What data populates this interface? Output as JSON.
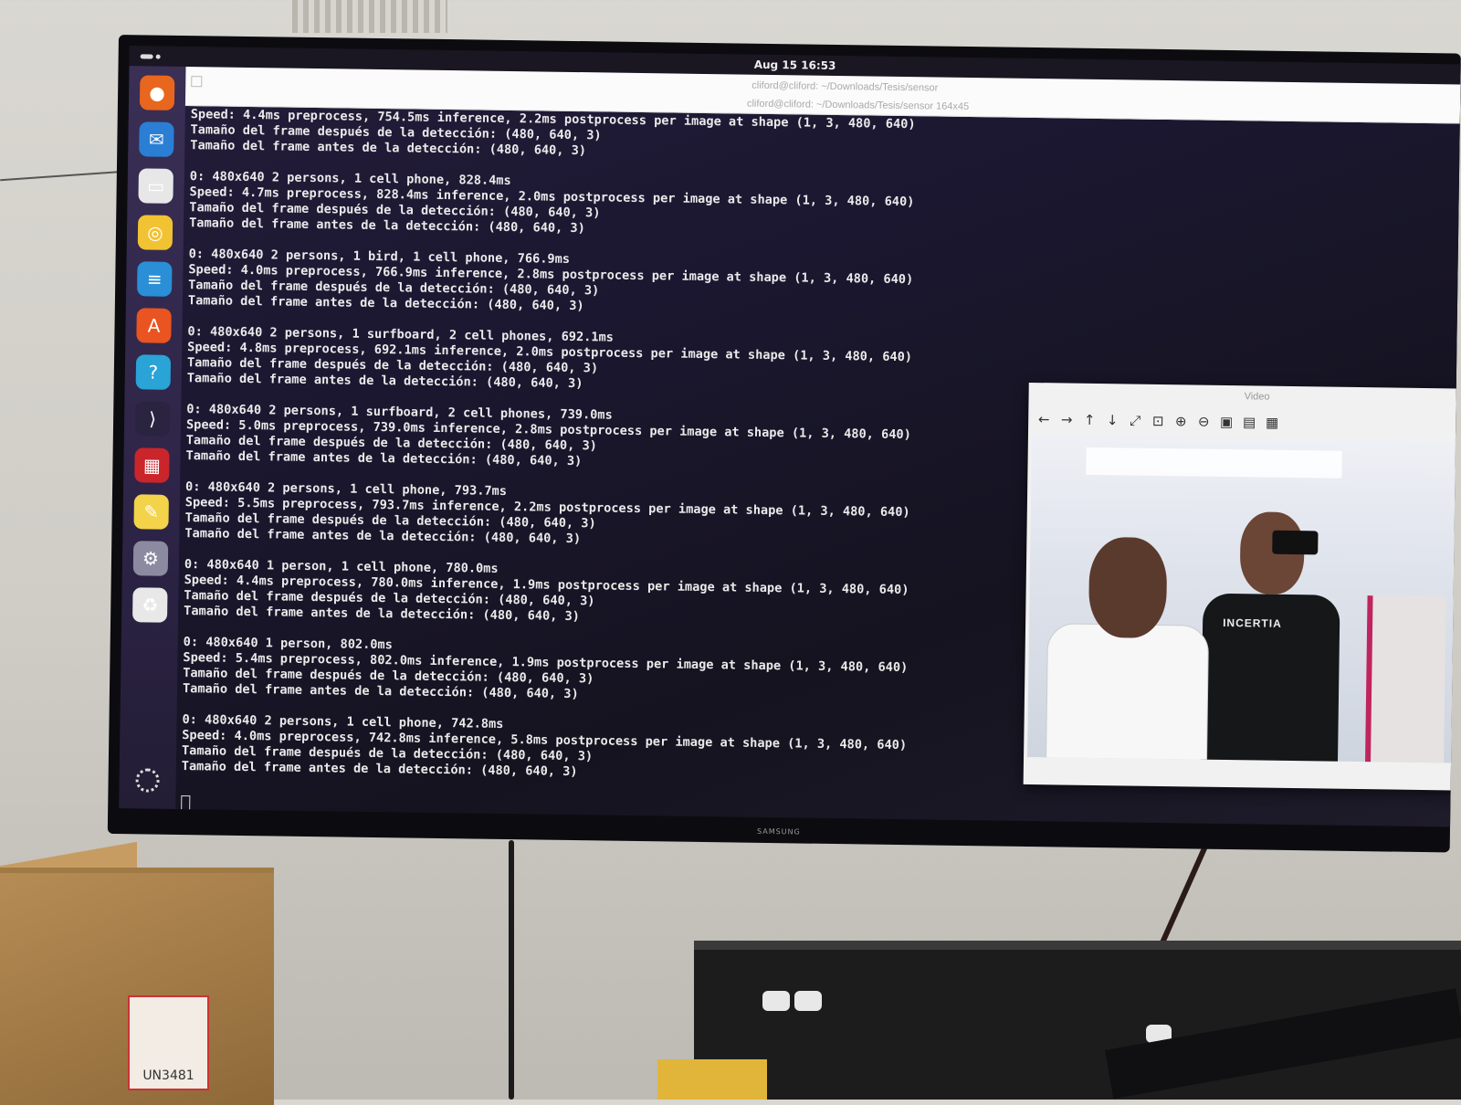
{
  "topbar": {
    "clock": "Aug 15  16:53"
  },
  "terminal": {
    "title_main": "cliford@cliford: ~/Downloads/Tesis/sensor",
    "title_tab": "cliford@cliford: ~/Downloads/Tesis/sensor 164x45",
    "blocks": [
      [
        "Speed: 4.4ms preprocess, 754.5ms inference, 2.2ms postprocess per image at shape (1, 3, 480, 640)",
        "Tamaño del frame después de la detección: (480, 640, 3)",
        "Tamaño del frame antes de la detección: (480, 640, 3)"
      ],
      [
        "0: 480x640 2 persons, 1 cell phone, 828.4ms",
        "Speed: 4.7ms preprocess, 828.4ms inference, 2.0ms postprocess per image at shape (1, 3, 480, 640)",
        "Tamaño del frame después de la detección: (480, 640, 3)",
        "Tamaño del frame antes de la detección: (480, 640, 3)"
      ],
      [
        "0: 480x640 2 persons, 1 bird, 1 cell phone, 766.9ms",
        "Speed: 4.0ms preprocess, 766.9ms inference, 2.8ms postprocess per image at shape (1, 3, 480, 640)",
        "Tamaño del frame después de la detección: (480, 640, 3)",
        "Tamaño del frame antes de la detección: (480, 640, 3)"
      ],
      [
        "0: 480x640 2 persons, 1 surfboard, 2 cell phones, 692.1ms",
        "Speed: 4.8ms preprocess, 692.1ms inference, 2.0ms postprocess per image at shape (1, 3, 480, 640)",
        "Tamaño del frame después de la detección: (480, 640, 3)",
        "Tamaño del frame antes de la detección: (480, 640, 3)"
      ],
      [
        "0: 480x640 2 persons, 1 surfboard, 2 cell phones, 739.0ms",
        "Speed: 5.0ms preprocess, 739.0ms inference, 2.8ms postprocess per image at shape (1, 3, 480, 640)",
        "Tamaño del frame después de la detección: (480, 640, 3)",
        "Tamaño del frame antes de la detección: (480, 640, 3)"
      ],
      [
        "0: 480x640 2 persons, 1 cell phone, 793.7ms",
        "Speed: 5.5ms preprocess, 793.7ms inference, 2.2ms postprocess per image at shape (1, 3, 480, 640)",
        "Tamaño del frame después de la detección: (480, 640, 3)",
        "Tamaño del frame antes de la detección: (480, 640, 3)"
      ],
      [
        "0: 480x640 1 person, 1 cell phone, 780.0ms",
        "Speed: 4.4ms preprocess, 780.0ms inference, 1.9ms postprocess per image at shape (1, 3, 480, 640)",
        "Tamaño del frame después de la detección: (480, 640, 3)",
        "Tamaño del frame antes de la detección: (480, 640, 3)"
      ],
      [
        "0: 480x640 1 person, 802.0ms",
        "Speed: 5.4ms preprocess, 802.0ms inference, 1.9ms postprocess per image at shape (1, 3, 480, 640)",
        "Tamaño del frame después de la detección: (480, 640, 3)",
        "Tamaño del frame antes de la detección: (480, 640, 3)"
      ],
      [
        "0: 480x640 2 persons, 1 cell phone, 742.8ms",
        "Speed: 4.0ms preprocess, 742.8ms inference, 5.8ms postprocess per image at shape (1, 3, 480, 640)",
        "Tamaño del frame después de la detección: (480, 640, 3)",
        "Tamaño del frame antes de la detección: (480, 640, 3)"
      ]
    ]
  },
  "video_window": {
    "title": "Video",
    "toolbar": [
      {
        "name": "pan-left-icon",
        "glyph": "←"
      },
      {
        "name": "pan-right-icon",
        "glyph": "→"
      },
      {
        "name": "pan-up-icon",
        "glyph": "↑"
      },
      {
        "name": "pan-down-icon",
        "glyph": "↓"
      },
      {
        "name": "zoom-fit-icon",
        "glyph": "⤢"
      },
      {
        "name": "zoom-original-icon",
        "glyph": "⊡"
      },
      {
        "name": "zoom-in-icon",
        "glyph": "⊕"
      },
      {
        "name": "zoom-out-icon",
        "glyph": "⊖"
      },
      {
        "name": "save-image-icon",
        "glyph": "▣"
      },
      {
        "name": "copy-image-icon",
        "glyph": "▤"
      },
      {
        "name": "properties-icon",
        "glyph": "▦"
      }
    ],
    "shirt_text": "INCERTIA"
  },
  "dock": [
    {
      "name": "firefox-icon",
      "bg": "#e8661e",
      "glyph": "●"
    },
    {
      "name": "thunderbird-icon",
      "bg": "#2a7fd4",
      "glyph": "✉"
    },
    {
      "name": "files-icon",
      "bg": "#e7e7e7",
      "glyph": "▭"
    },
    {
      "name": "rhythmbox-icon",
      "bg": "#f1c232",
      "glyph": "◎"
    },
    {
      "name": "writer-icon",
      "bg": "#2a8fd6",
      "glyph": "≡"
    },
    {
      "name": "app-center-icon",
      "bg": "#e95420",
      "glyph": "A"
    },
    {
      "name": "help-icon",
      "bg": "#2aa3d6",
      "glyph": "?"
    },
    {
      "name": "vscode-icon",
      "bg": "#2a2440",
      "glyph": "⟩"
    },
    {
      "name": "screen-recorder-icon",
      "bg": "#c9252b",
      "glyph": "▦"
    },
    {
      "name": "text-editor-icon",
      "bg": "#f2d349",
      "glyph": "✎"
    },
    {
      "name": "settings-icon",
      "bg": "#8c8aa0",
      "glyph": "⚙"
    },
    {
      "name": "trash-icon",
      "bg": "#e8e8e8",
      "glyph": "♻"
    }
  ],
  "scene": {
    "tv_brand": "SAMSUNG",
    "box_label": "UN3481"
  }
}
